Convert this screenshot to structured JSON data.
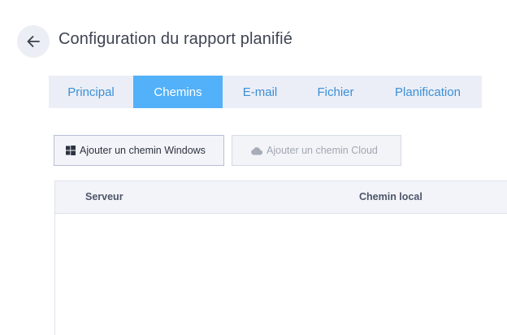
{
  "header": {
    "title": "Configuration du rapport planifié",
    "back_icon": "arrow-left-icon"
  },
  "tabs": [
    {
      "label": "Principal",
      "active": false
    },
    {
      "label": "Chemins",
      "active": true
    },
    {
      "label": "E-mail",
      "active": false
    },
    {
      "label": "Fichier",
      "active": false
    },
    {
      "label": "Planification",
      "active": false
    }
  ],
  "toolbar": {
    "add_windows_label": "Ajouter un chemin Windows",
    "add_windows_icon": "windows-icon",
    "add_cloud_label": "Ajouter un chemin Cloud",
    "add_cloud_icon": "cloud-icon",
    "add_cloud_disabled": true
  },
  "table": {
    "columns": [
      "Serveur",
      "Chemin local"
    ],
    "rows": []
  },
  "colors": {
    "accent": "#52b1f8",
    "tab_text": "#3b8fd6",
    "tab_bar": "#ebeef7"
  }
}
